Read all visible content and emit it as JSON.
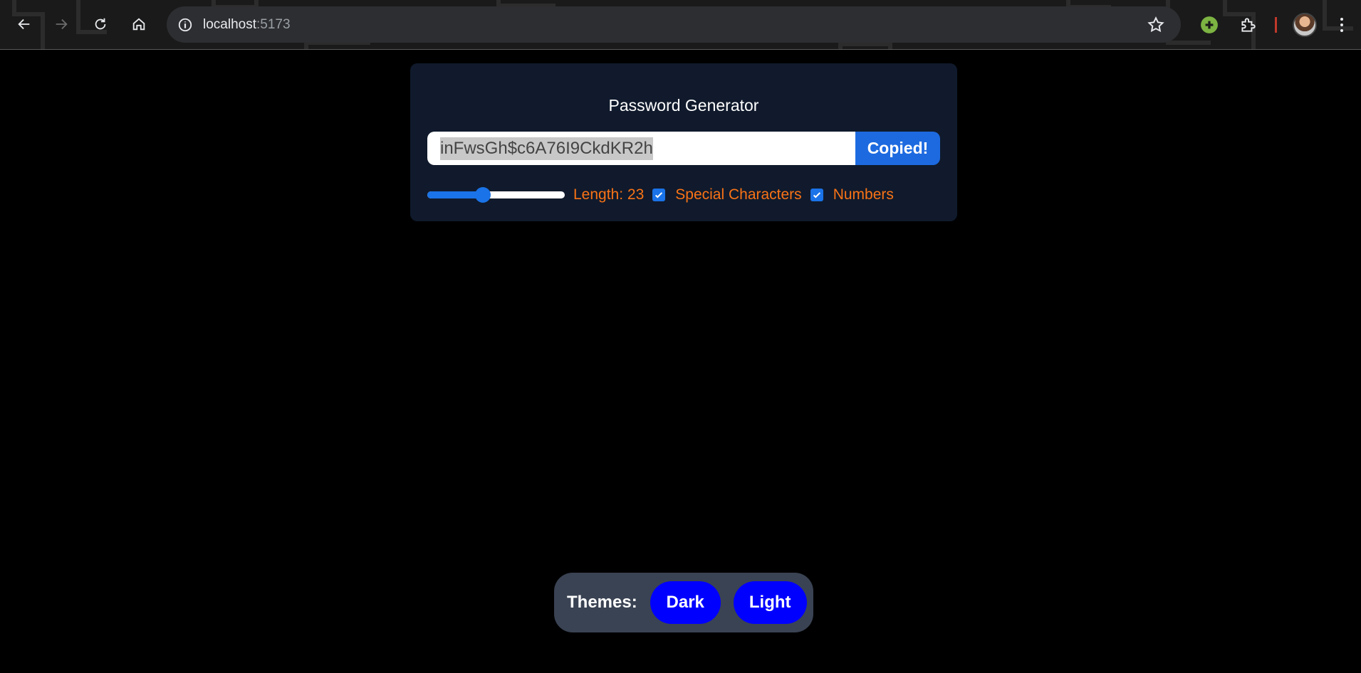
{
  "browser": {
    "url_host": "localhost",
    "url_port": ":5173"
  },
  "generator": {
    "title": "Password Generator",
    "password": "inFwsGh$c6A76I9CkdKR2h",
    "copy_label": "Copied!",
    "length_label": "Length: 23",
    "length_value": 23,
    "length_fraction": 0.39,
    "special_label": "Special Characters",
    "special_checked": true,
    "numbers_label": "Numbers",
    "numbers_checked": true
  },
  "themes": {
    "label": "Themes:",
    "dark_label": "Dark",
    "light_label": "Light"
  },
  "colors": {
    "card_bg": "#101a2c",
    "accent_blue": "#1d6ae0",
    "option_orange": "#f97316",
    "theme_button": "#0000ff",
    "themes_bg": "#3a4353"
  }
}
